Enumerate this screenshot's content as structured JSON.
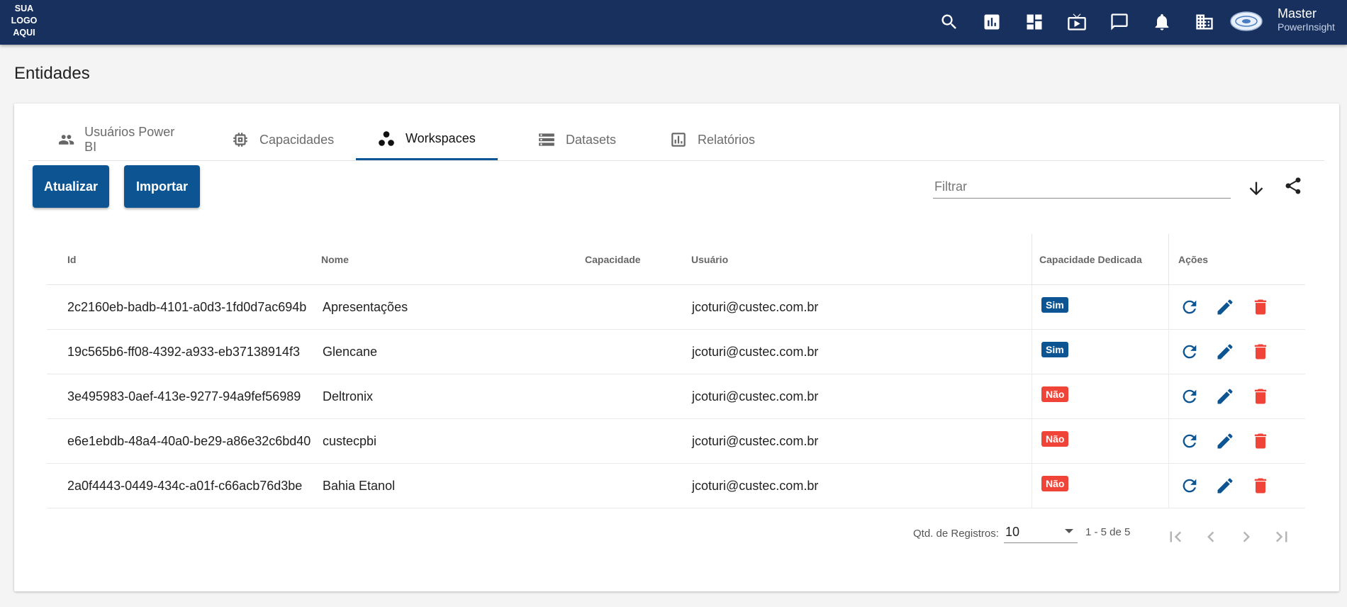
{
  "header": {
    "logo_lines": [
      "SUA",
      "LOGO",
      "AQUI"
    ],
    "icons": [
      "search-icon",
      "report-icon",
      "dashboard-icon",
      "tv-icon",
      "chat-icon",
      "bell-icon",
      "building-icon"
    ],
    "user_name": "Master",
    "user_org": "PowerInsight"
  },
  "page": {
    "title": "Entidades"
  },
  "tabs": [
    {
      "label": "Usuários Power BI",
      "icon": "users-icon",
      "active": false
    },
    {
      "label": "Capacidades",
      "icon": "chip-icon",
      "active": false
    },
    {
      "label": "Workspaces",
      "icon": "workspaces-icon",
      "active": true
    },
    {
      "label": "Datasets",
      "icon": "storage-icon",
      "active": false
    },
    {
      "label": "Relatórios",
      "icon": "chart-icon",
      "active": false
    }
  ],
  "toolbar": {
    "refresh_label": "Atualizar",
    "import_label": "Importar",
    "filter_placeholder": "Filtrar",
    "filter_value": ""
  },
  "table": {
    "columns": {
      "id": "Id",
      "name": "Nome",
      "capacity": "Capacidade",
      "user": "Usuário",
      "dedicated": "Capacidade Dedicada",
      "actions": "Ações"
    },
    "rows": [
      {
        "id": "2c2160eb-badb-4101-a0d3-1fd0d7ac694b",
        "name": "Apresentações",
        "capacity": "",
        "user": "jcoturi@custec.com.br",
        "dedicated": "Sim"
      },
      {
        "id": "19c565b6-ff08-4392-a933-eb37138914f3",
        "name": "Glencane",
        "capacity": "",
        "user": "jcoturi@custec.com.br",
        "dedicated": "Sim"
      },
      {
        "id": "3e495983-0aef-413e-9277-94a9fef56989",
        "name": "Deltronix",
        "capacity": "",
        "user": "jcoturi@custec.com.br",
        "dedicated": "Não"
      },
      {
        "id": "e6e1ebdb-48a4-40a0-be29-a86e32c6bd40",
        "name": "custecpbi",
        "capacity": "",
        "user": "jcoturi@custec.com.br",
        "dedicated": "Não"
      },
      {
        "id": "2a0f4443-0449-434c-a01f-c66acb76d3be",
        "name": "Bahia Etanol",
        "capacity": "",
        "user": "jcoturi@custec.com.br",
        "dedicated": "Não"
      }
    ]
  },
  "pagination": {
    "label": "Qtd. de Registros:",
    "page_size": "10",
    "range": "1 - 5 de 5"
  },
  "colors": {
    "header_bg": "#17305e",
    "primary": "#0d5592",
    "badge_yes": "#0d5592",
    "badge_no": "#f04438",
    "delete": "#f04438"
  }
}
